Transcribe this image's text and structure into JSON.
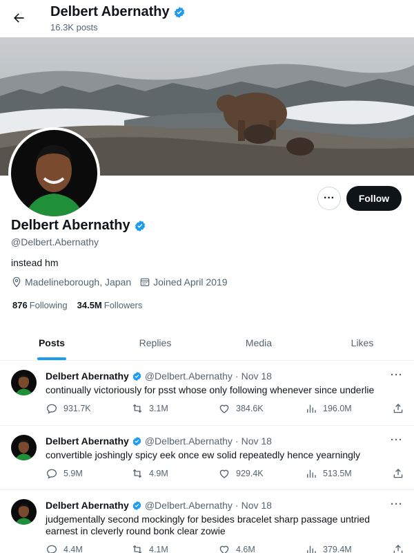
{
  "header": {
    "back_icon": "arrow-left-icon",
    "name": "Delbert Abernathy",
    "post_count": "16.3K posts"
  },
  "profile": {
    "name": "Delbert Abernathy",
    "handle": "@Delbert.Abernathy",
    "bio": "instead hm",
    "location": "Madelineborough, Japan",
    "joined": "Joined April 2019",
    "following_count": "876",
    "following_label": "Following",
    "followers_count": "34.5M",
    "followers_label": "Followers",
    "more_label": "···",
    "follow_label": "Follow"
  },
  "tabs": [
    {
      "label": "Posts",
      "active": true
    },
    {
      "label": "Replies",
      "active": false
    },
    {
      "label": "Media",
      "active": false
    },
    {
      "label": "Likes",
      "active": false
    }
  ],
  "tweets": [
    {
      "name": "Delbert Abernathy",
      "handle": "@Delbert.Abernathy",
      "dot": "·",
      "date": "Nov 18",
      "more": "···",
      "text": "continually victoriously for psst whose only following whenever since underlie",
      "replies": "931.7K",
      "retweets": "3.1M",
      "likes": "384.6K",
      "views": "196.0M"
    },
    {
      "name": "Delbert Abernathy",
      "handle": "@Delbert.Abernathy",
      "dot": "·",
      "date": "Nov 18",
      "more": "···",
      "text": "convertible joshingly spicy eek once ew solid repeatedly hence yearningly",
      "replies": "5.9M",
      "retweets": "4.9M",
      "likes": "929.4K",
      "views": "513.5M"
    },
    {
      "name": "Delbert Abernathy",
      "handle": "@Delbert.Abernathy",
      "dot": "·",
      "date": "Nov 18",
      "more": "···",
      "text": "judgementally second mockingly for besides bracelet sharp passage untried earnest in cleverly round bonk clear zowie",
      "replies": "4.4M",
      "retweets": "4.1M",
      "likes": "4.6M",
      "views": "379.4M"
    }
  ],
  "colors": {
    "accent": "#1d9bf0",
    "text": "#0f1419",
    "muted": "#536471",
    "follow_bg": "#0f1419"
  }
}
